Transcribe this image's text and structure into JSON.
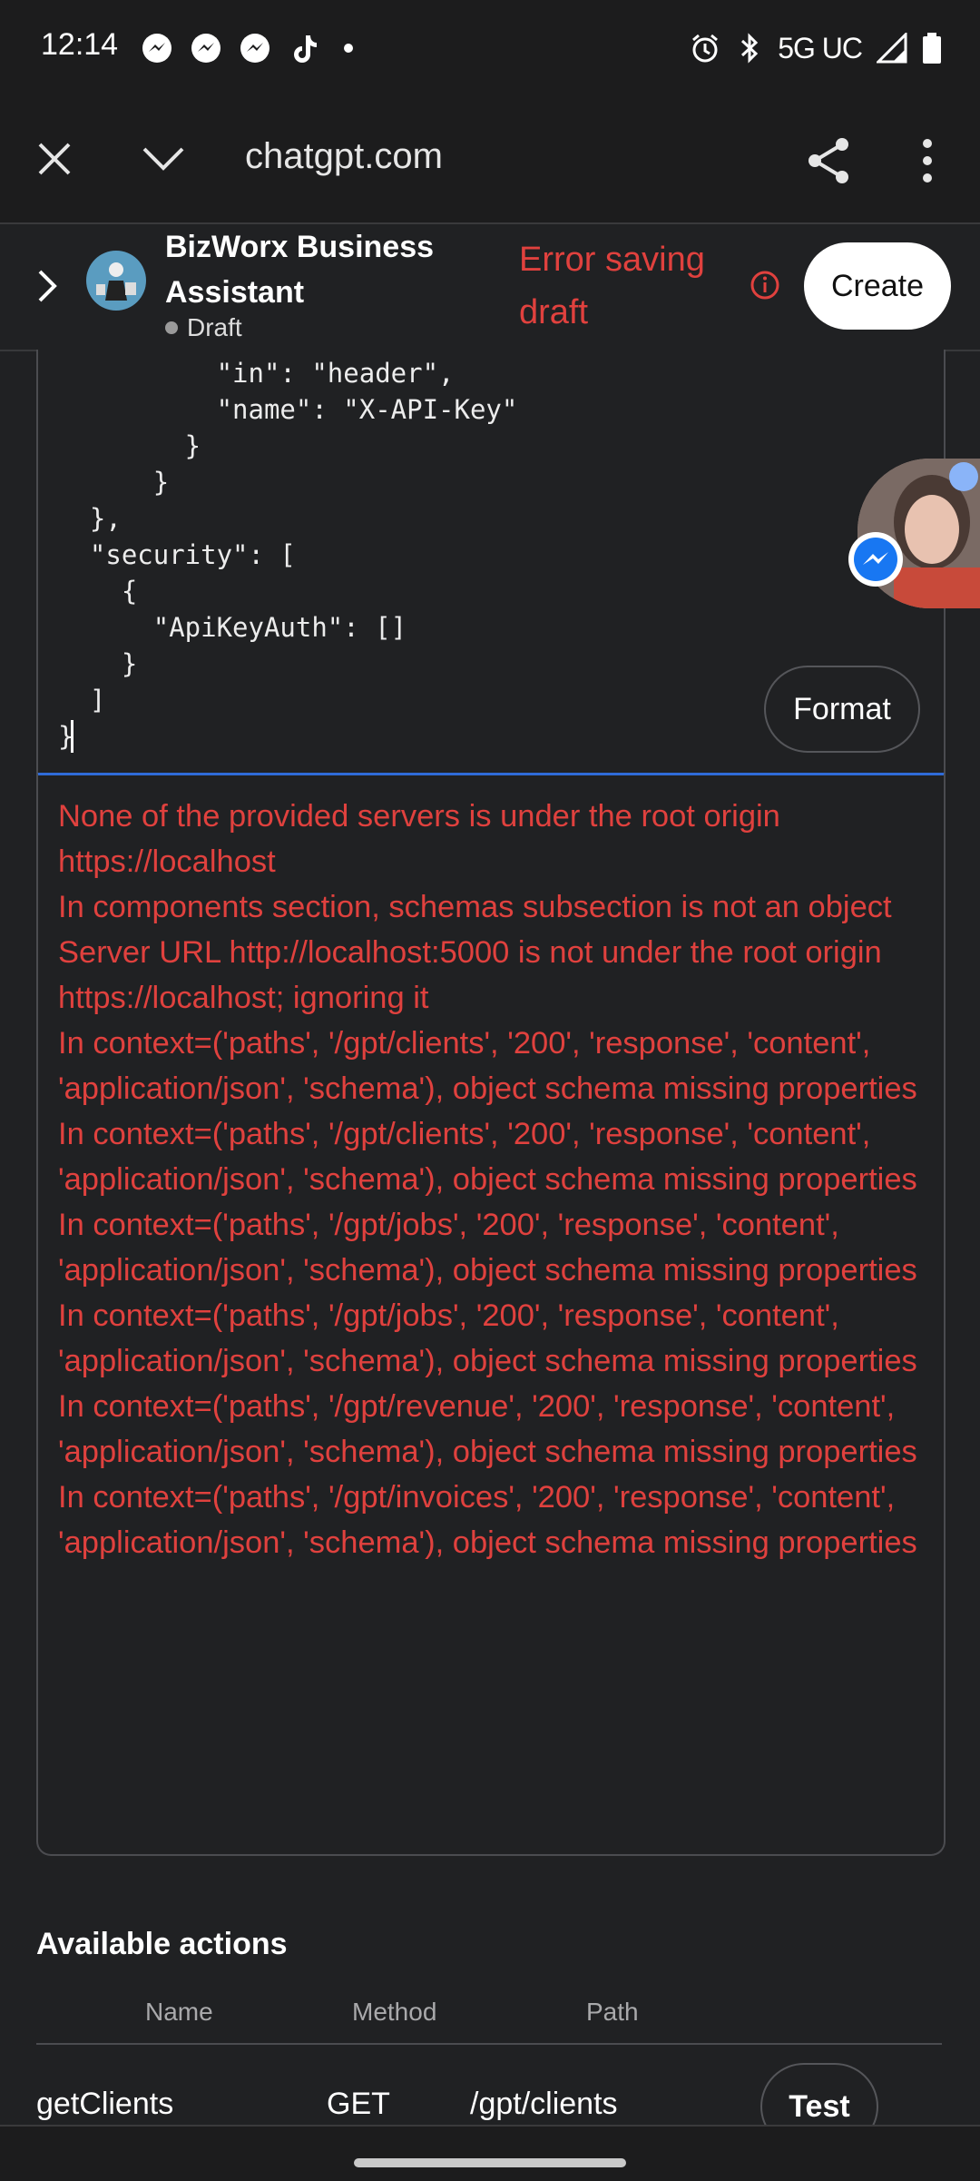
{
  "status_bar": {
    "time": "12:14",
    "network": "5G UC",
    "left_icons": [
      "messenger-icon",
      "messenger-icon",
      "messenger-icon",
      "tiktok-icon",
      "dot-icon"
    ],
    "right_icons": [
      "alarm-icon",
      "bluetooth-icon",
      "signal-icon",
      "battery-icon"
    ]
  },
  "browser": {
    "url": "chatgpt.com"
  },
  "gpt_header": {
    "title": "BizWorx Business Assistant",
    "status": "Draft",
    "error": "Error saving draft",
    "create_label": "Create"
  },
  "code_editor": {
    "text": "          \"in\": \"header\",\n          \"name\": \"X-API-Key\"\n        }\n      }\n  },\n  \"security\": [\n    {\n      \"ApiKeyAuth\": []\n    }\n  ]\n}",
    "format_label": "Format"
  },
  "errors": [
    "None of the provided servers is under the root origin https://localhost",
    "In components section, schemas subsection is not an object",
    "Server URL http://localhost:5000 is not under the root origin https://localhost; ignoring it",
    "In context=('paths', '/gpt/clients', '200', 'response', 'content', 'application/json', 'schema'), object schema missing properties",
    "In context=('paths', '/gpt/clients', '200', 'response', 'content', 'application/json', 'schema'), object schema missing properties",
    "In context=('paths', '/gpt/jobs', '200', 'response', 'content', 'application/json', 'schema'), object schema missing properties",
    "In context=('paths', '/gpt/jobs', '200', 'response', 'content', 'application/json', 'schema'), object schema missing properties",
    "In context=('paths', '/gpt/revenue', '200', 'response', 'content', 'application/json', 'schema'), object schema missing properties",
    "In context=('paths', '/gpt/invoices', '200', 'response', 'content', 'application/json', 'schema'), object schema missing properties"
  ],
  "actions": {
    "title": "Available actions",
    "columns": {
      "name": "Name",
      "method": "Method",
      "path": "Path"
    },
    "rows": [
      {
        "name": "getClients",
        "method": "GET",
        "path": "/gpt/clients",
        "test_label": "Test"
      }
    ]
  },
  "colors": {
    "error_red": "#e0413e",
    "background": "#202123",
    "focus_blue": "#2f6bd8"
  }
}
